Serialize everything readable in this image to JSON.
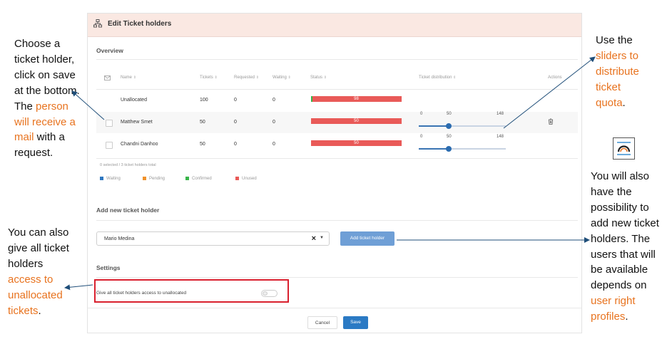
{
  "annotations": {
    "choose": {
      "parts": [
        "Choose a ticket holder, click on save at the bottom. The ",
        "person will receive a mail",
        " with a request."
      ]
    },
    "access": {
      "parts": [
        "You can also give all ticket holders ",
        "access to unallocated tickets",
        "."
      ]
    },
    "sliders": {
      "parts": [
        "Use the ",
        "sliders to distribute ticket quota",
        "."
      ]
    },
    "add": {
      "parts": [
        "You will also have the possibility to add new ticket holders. The users that will be available depends on ",
        "user right profiles",
        "."
      ]
    }
  },
  "modal": {
    "title": "Edit Ticket holders",
    "overview_label": "Overview",
    "columns": {
      "name": "Name",
      "tickets": "Tickets",
      "requested": "Requested",
      "waiting": "Waiting",
      "status": "Status",
      "distribution": "Ticket distribution",
      "actions": "Actions"
    },
    "rows": [
      {
        "name": "Unallocated",
        "tickets": "100",
        "requested": "0",
        "waiting": "0",
        "bar_label": "98"
      },
      {
        "name": "Matthew Smet",
        "tickets": "50",
        "requested": "0",
        "waiting": "0",
        "bar_label": "50",
        "slider": {
          "min": "0",
          "value": "50",
          "max": "148"
        }
      },
      {
        "name": "Chandni Danhoo",
        "tickets": "50",
        "requested": "0",
        "waiting": "0",
        "bar_label": "50",
        "slider": {
          "min": "0",
          "value": "50",
          "max": "148"
        }
      }
    ],
    "footnote": "0 selected / 3 ticket holders total",
    "legend": [
      {
        "label": "Waiting",
        "color": "#2f77c0"
      },
      {
        "label": "Pending",
        "color": "#f0922b"
      },
      {
        "label": "Confirmed",
        "color": "#39b54a"
      },
      {
        "label": "Unused",
        "color": "#e95a58"
      }
    ],
    "add_section_label": "Add new ticket holder",
    "add_input_value": "Mario Medina",
    "add_button": "Add ticket holder",
    "settings_label": "Settings",
    "settings_toggle_label": "Give all ticket holders access to unallocated",
    "cancel_button": "Cancel",
    "save_button": "Save"
  },
  "icons": {
    "header": "org-chart-icon",
    "mail": "mail-icon",
    "trash": "trash-icon",
    "floating": "rainbow-icon"
  },
  "colors": {
    "accent_text": "#e8731f",
    "header_bg": "#fae8e2",
    "unused": "#e95a58",
    "primary": "#2b7ac4",
    "highlight_box": "#d9202e",
    "arrow": "#1f4e79"
  }
}
